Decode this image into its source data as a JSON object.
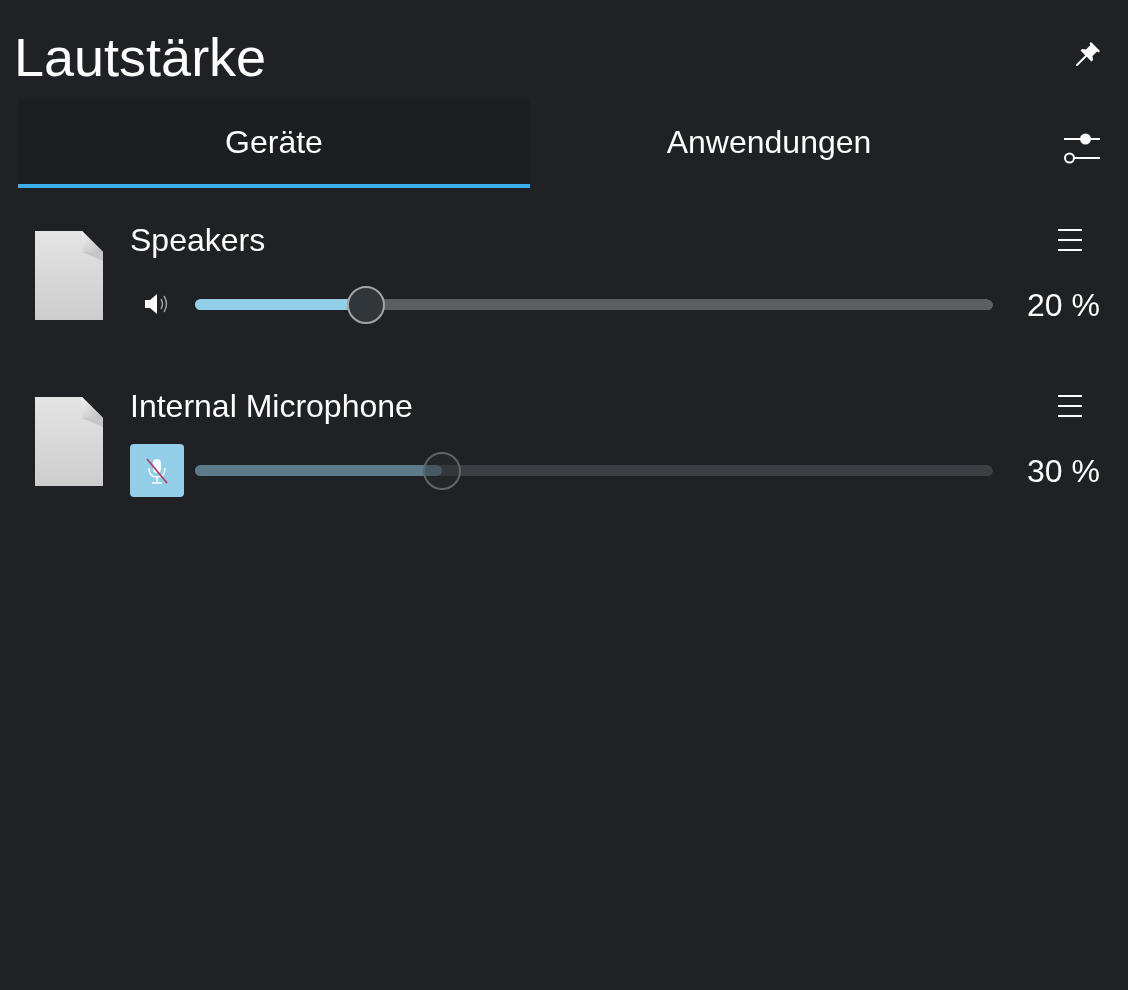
{
  "title": "Lautstärke",
  "tabs": [
    {
      "label": "Geräte",
      "selected": true
    },
    {
      "label": "Anwendungen",
      "selected": false
    }
  ],
  "devices": [
    {
      "name": "Speakers",
      "kind": "speaker",
      "muted": false,
      "level": 0.2,
      "reading": "20 %"
    },
    {
      "name": "Internal Microphone",
      "kind": "microphone",
      "muted": true,
      "level": 0.3,
      "reading": "30 %"
    }
  ]
}
